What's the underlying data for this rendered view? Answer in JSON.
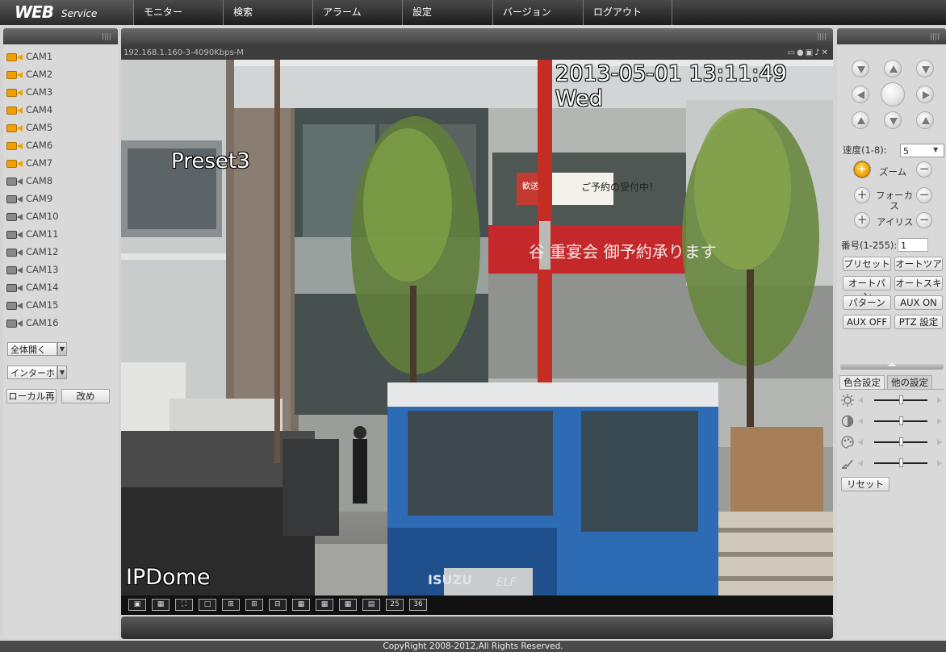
{
  "logo": {
    "main": "WEB",
    "sub": "Service"
  },
  "nav": [
    {
      "label": "モニター"
    },
    {
      "label": "検索"
    },
    {
      "label": "アラーム"
    },
    {
      "label": "設定"
    },
    {
      "label": "バージョン"
    },
    {
      "label": "ログアウト"
    }
  ],
  "cameras": [
    {
      "label": "CAM1",
      "active": true
    },
    {
      "label": "CAM2",
      "active": true
    },
    {
      "label": "CAM3",
      "active": true
    },
    {
      "label": "CAM4",
      "active": true
    },
    {
      "label": "CAM5",
      "active": true
    },
    {
      "label": "CAM6",
      "active": true
    },
    {
      "label": "CAM7",
      "active": true
    },
    {
      "label": "CAM8",
      "active": false
    },
    {
      "label": "CAM9",
      "active": false
    },
    {
      "label": "CAM10",
      "active": false
    },
    {
      "label": "CAM11",
      "active": false
    },
    {
      "label": "CAM12",
      "active": false
    },
    {
      "label": "CAM13",
      "active": false
    },
    {
      "label": "CAM14",
      "active": false
    },
    {
      "label": "CAM15",
      "active": false
    },
    {
      "label": "CAM16",
      "active": false
    }
  ],
  "left": {
    "open_all": "全体開く",
    "stream": "インターホ",
    "local_play": "ローカル再",
    "refresh": "改め"
  },
  "video": {
    "info": "192.168.1.160-3-4090Kbps-M",
    "timestamp": "2013-05-01 13:11:49 Wed",
    "preset": "Preset3",
    "channel_name": "IPDome",
    "sign_upper": "ご予約の受付中！",
    "sign_left": "歓送",
    "sign_banner": "谷 重宴会  御予約承ります",
    "truck_brand": "ISUZU",
    "truck_model": "ELF"
  },
  "layouts": [
    "",
    "",
    "",
    "",
    "",
    "",
    "",
    "",
    "",
    "",
    "",
    "25",
    "36"
  ],
  "ptz": {
    "speed_label": "速度(1-8):",
    "speed_value": "5",
    "zoom": "ズーム",
    "focus": "フォーカス",
    "iris": "アイリス",
    "number_label": "番号(1-255):",
    "number_value": "1",
    "buttons": [
      "プリセット",
      "オートツア",
      "オートパン",
      "オートスキ",
      "パターン",
      "AUX ON",
      "AUX OFF",
      "PTZ 設定"
    ]
  },
  "color": {
    "tab_active": "色合設定",
    "tab_other": "他の設定",
    "levels": [
      0.5,
      0.5,
      0.5,
      0.5
    ],
    "reset": "リセット"
  },
  "footer": "CopyRight 2008-2012,All Rights Reserved.",
  "colors": {
    "accent": "#f2a000",
    "header_dark": "#2c2c2c"
  }
}
